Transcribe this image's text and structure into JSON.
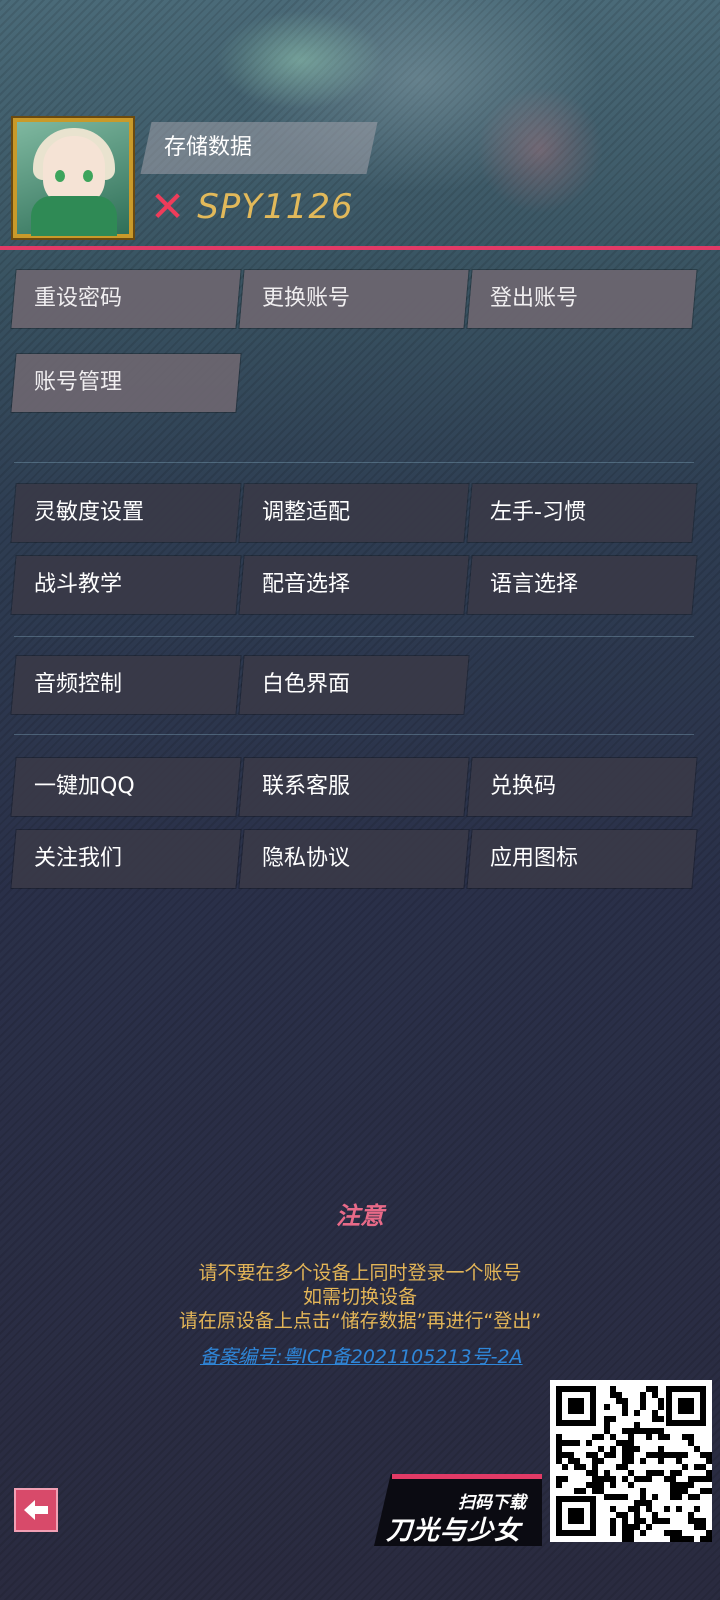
{
  "header": {
    "save_tab_label": "存储数据",
    "user_id": "SPY1126",
    "avatar_icon": "character-avatar-icon",
    "status_icon": "x-mark-icon"
  },
  "account_buttons": [
    "重设密码",
    "更换账号",
    "登出账号",
    "账号管理"
  ],
  "settings_buttons": [
    "灵敏度设置",
    "调整适配",
    "左手-习惯",
    "战斗教学",
    "配音选择",
    "语言选择"
  ],
  "audio_buttons": [
    "音频控制",
    "白色界面"
  ],
  "social_buttons": [
    "一键加QQ",
    "联系客服",
    "兑换码",
    "关注我们",
    "隐私协议",
    "应用图标"
  ],
  "notice": {
    "title": "注意",
    "line1": "请不要在多个设备上同时登录一个账号",
    "line2": "如需切换设备",
    "line3": "请在原设备上点击“储存数据”再进行“登出”"
  },
  "icp_text": "备案编号:粤ICP备2021105213号-2A",
  "footer": {
    "scan_label": "扫码下载",
    "game_title": "刀光与少女",
    "back_icon": "back-arrow-icon",
    "qr_icon": "qr-code-icon"
  },
  "colors": {
    "accent_red": "#e23a66",
    "uid_gold": "#e2b95a",
    "notice_text": "#e3b557",
    "notice_title": "#e86a88",
    "link_blue": "#2f86d8"
  }
}
